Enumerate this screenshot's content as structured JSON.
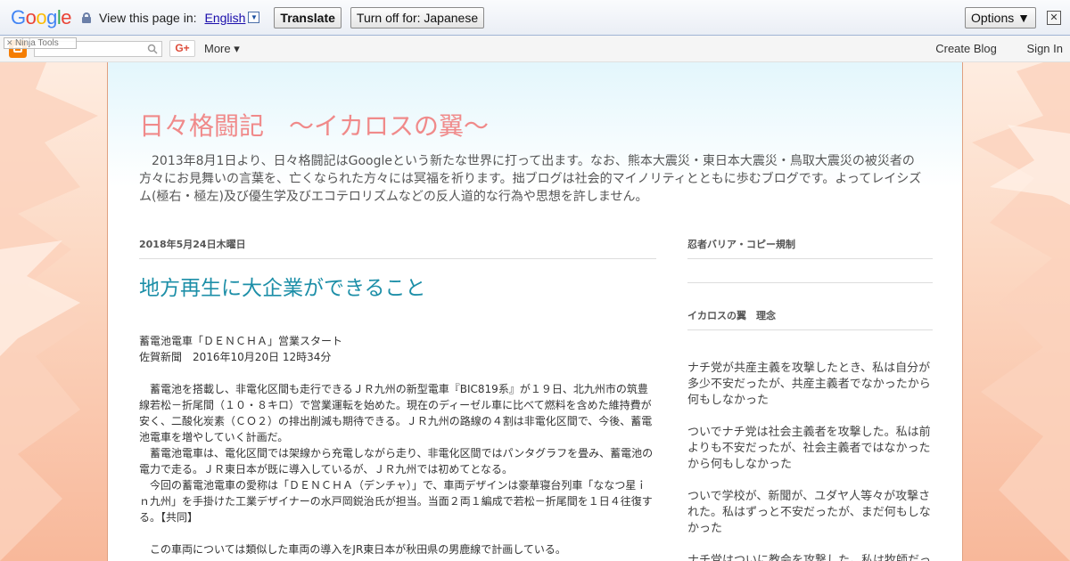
{
  "translate_bar": {
    "logo_letters": [
      "G",
      "o",
      "o",
      "g",
      "l",
      "e"
    ],
    "view_text": "View this page in:",
    "language": "English",
    "dropdown_glyph": "▼",
    "translate_label": "Translate",
    "turn_off_label": "Turn off for: Japanese",
    "options_label": "Options ▼",
    "close_glyph": "✕"
  },
  "navbar": {
    "ninja_tag": "Ninja Tools",
    "gplus_label": "G+",
    "more_label": "More ▾",
    "create_blog": "Create Blog",
    "sign_in": "Sign In"
  },
  "blog": {
    "title": "日々格闘記　～イカロスの翼～",
    "description": "　2013年8月1日より、日々格闘記はGoogleという新たな世界に打って出ます。なお、熊本大震災・東日本大震災・鳥取大震災の被災者の方々にお見舞いの言葉を、亡くなられた方々には冥福を祈ります。拙ブログは社会的マイノリティとともに歩むブログです。よってレイシズム(極右・極左)及び優生学及びエコテロリズムなどの反人道的な行為や思想を許しません。"
  },
  "post": {
    "date": "2018年5月24日木曜日",
    "title": "地方再生に大企業ができること",
    "lines": [
      "蓄電池電車「ＤＥＮＣＨＡ」営業スタート",
      "佐賀新聞　2016年10月20日 12時34分",
      "",
      "　蓄電池を搭載し、非電化区間も走行できるＪＲ九州の新型電車『BIC819系』が１９日、北九州市の筑豊線若松－折尾間（１０・８キロ）で営業運転を始めた。現在のディーゼル車に比べて燃料を含めた維持費が安く、二酸化炭素（ＣＯ２）の排出削減も期待できる。ＪＲ九州の路線の４割は非電化区間で、今後、蓄電池電車を増やしていく計画だ。",
      "　蓄電池電車は、電化区間では架線から充電しながら走り、非電化区間ではパンタグラフを畳み、蓄電池の電力で走る。ＪＲ東日本が既に導入しているが、ＪＲ九州では初めてとなる。",
      "　今回の蓄電池電車の愛称は「ＤＥＮＣＨＡ（デンチャ）」で、車両デザインは豪華寝台列車「ななつ星ｉｎ九州」を手掛けた工業デザイナーの水戸岡鋭治氏が担当。当面２両１編成で若松－折尾間を１日４往復する。【共同】",
      "",
      "　この車両については類似した車両の導入をJR東日本が秋田県の男鹿線で計画している。"
    ]
  },
  "sidebar": {
    "widget1_title": "忍者バリア・コピー規制",
    "widget2_title": "イカロスの翼　理念",
    "paragraphs": [
      "ナチ党が共産主義を攻撃したとき、私は自分が多少不安だったが、共産主義者でなかったから何もしなかった",
      "ついでナチ党は社会主義者を攻撃した。私は前よりも不安だったが、社会主義者ではなかったから何もしなかった",
      "ついで学校が、新聞が、ユダヤ人等々が攻撃された。私はずっと不安だったが、まだ何もしなかった",
      "ナチ党はついに教会を攻撃した。私は牧師だっ"
    ]
  },
  "colors": {
    "title": "#f08a8a",
    "post_title": "#1d8fa8",
    "background_peach": "#fbe3d3"
  }
}
